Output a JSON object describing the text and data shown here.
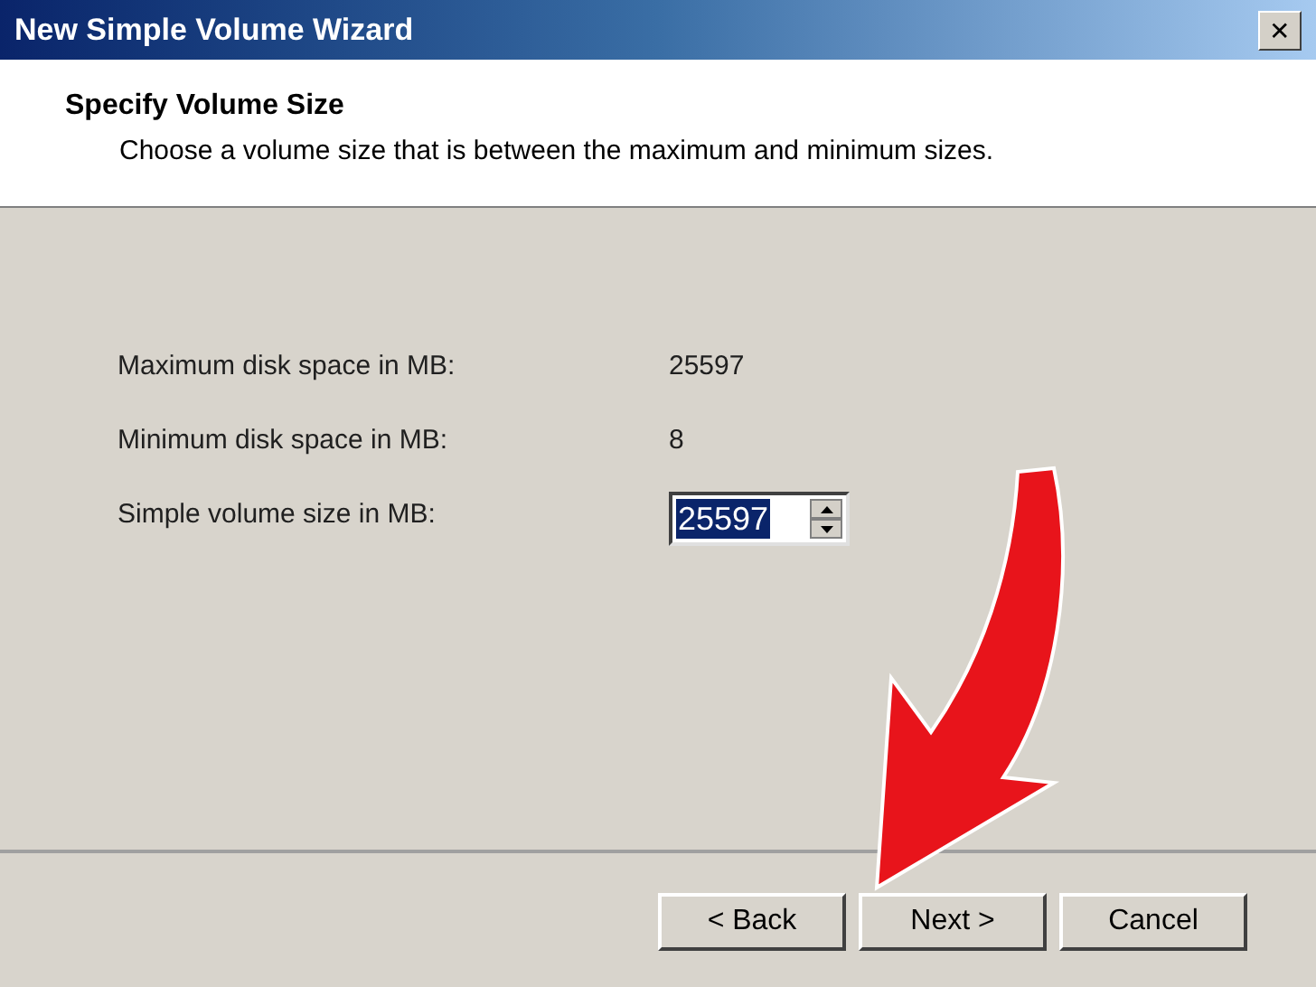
{
  "window": {
    "title": "New Simple Volume Wizard",
    "close": "✕"
  },
  "header": {
    "title": "Specify Volume Size",
    "subtitle": "Choose a volume size that is between the maximum and minimum sizes."
  },
  "fields": [
    {
      "kind": "text",
      "label": "Maximum disk space in MB:",
      "value": "25597"
    },
    {
      "kind": "text",
      "label": "Minimum disk space in MB:",
      "value": "8"
    },
    {
      "kind": "spin",
      "label": "Simple volume size in MB:",
      "value": "25597"
    }
  ],
  "buttons": [
    "< Back",
    "Next >",
    "Cancel"
  ]
}
